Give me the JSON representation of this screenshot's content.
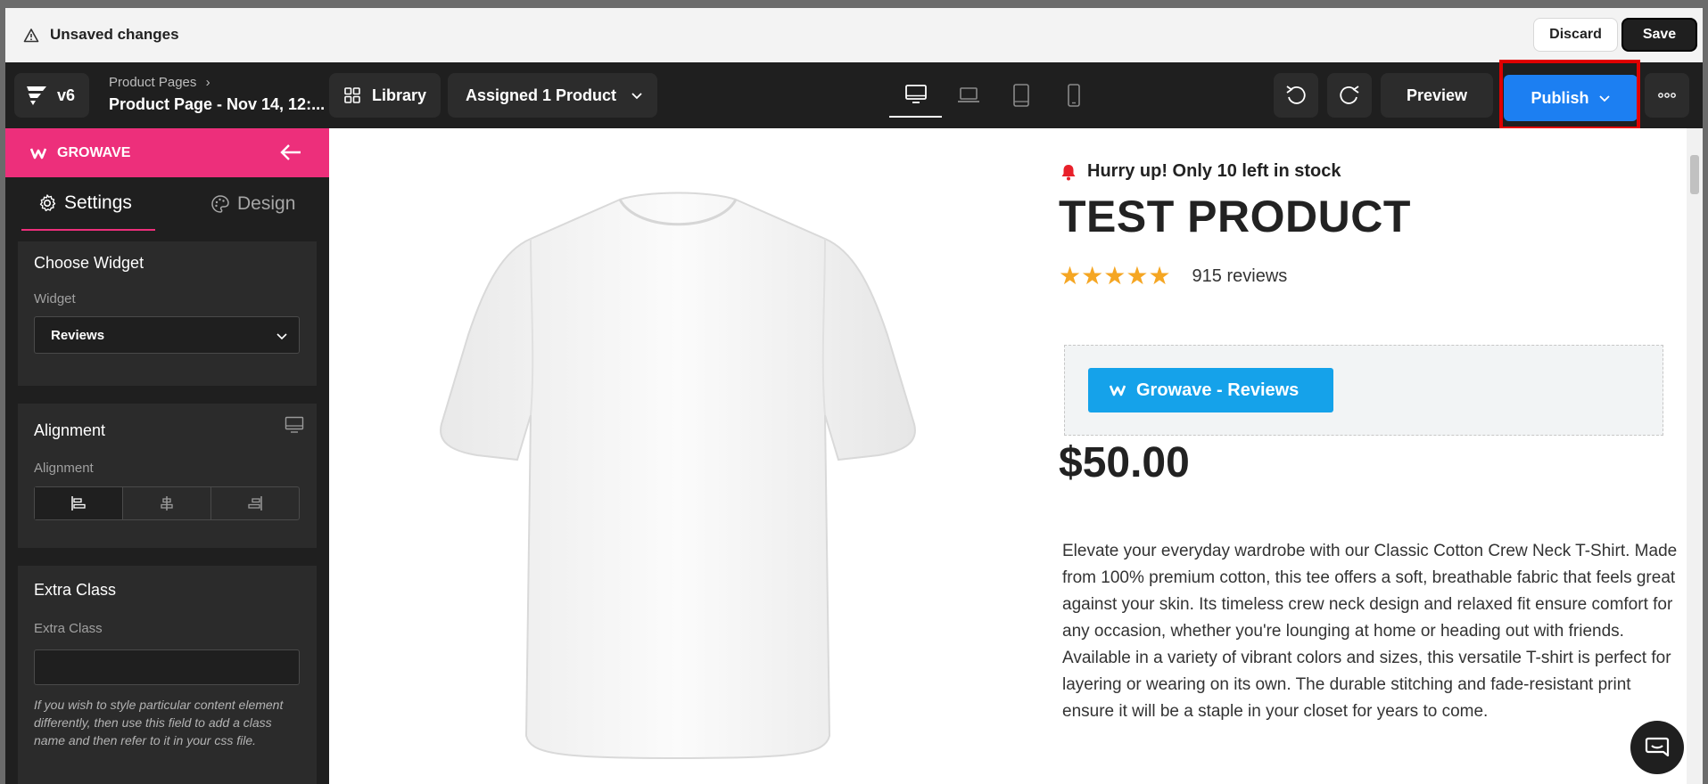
{
  "unsaved": {
    "text": "Unsaved changes",
    "discard": "Discard",
    "save": "Save"
  },
  "toolbar": {
    "version": "v6",
    "breadcrumb_parent": "Product Pages",
    "breadcrumb_current": "Product Page - Nov 14, 12:...",
    "library": "Library",
    "assigned": "Assigned 1 Product",
    "preview": "Preview",
    "publish": "Publish"
  },
  "sidebar": {
    "app_name": "GROWAVE",
    "tabs": {
      "settings": "Settings",
      "design": "Design"
    },
    "choose_widget": {
      "title": "Choose Widget",
      "label": "Widget",
      "value": "Reviews"
    },
    "alignment": {
      "title": "Alignment",
      "label": "Alignment"
    },
    "extra_class": {
      "title": "Extra Class",
      "label": "Extra Class",
      "help": "If you wish to style particular content element differently, then use this field to add a class name and then refer to it in your css file."
    }
  },
  "product": {
    "stock": "Hurry up! Only 10 left in stock",
    "title": "TEST PRODUCT",
    "rating_stars": 5,
    "reviews": "915 reviews",
    "widget_button": "Growave - Reviews",
    "price": "$50.00",
    "description_1": "Elevate your everyday wardrobe with our Classic Cotton Crew Neck T-Shirt. Made from 100% premium cotton, this tee offers a soft, breathable fabric that feels great against your skin. Its timeless crew neck design and relaxed fit ensure comfort for any occasion, whether you're lounging at home or heading out with friends.",
    "description_2": "Available in a variety of vibrant colors and sizes, this versatile T-shirt is perfect for layering or wearing on its own. The durable stitching and fade-resistant print ensure it will be a staple in your closet for years to come."
  },
  "colors": {
    "publish": "#1c7ff2",
    "growave": "#ed2f7b",
    "widget_button": "#15a2ea",
    "star": "#f5a623"
  }
}
